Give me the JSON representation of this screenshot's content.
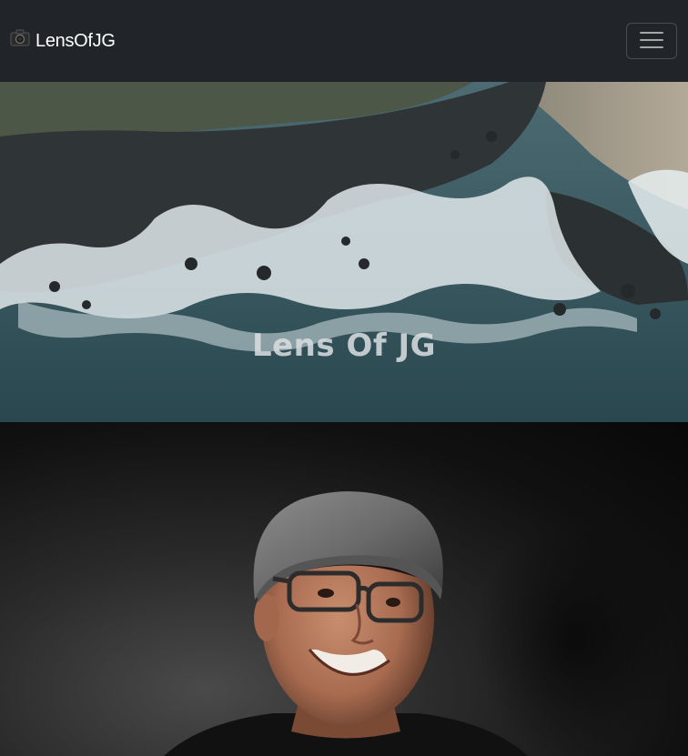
{
  "navbar": {
    "brand_icon": "camera-icon",
    "brand_text": "LensOfJG",
    "toggler_icon": "hamburger-menu-icon"
  },
  "hero": {
    "title": "Lens Of JG",
    "image": "aerial-coastline-waves-photo"
  },
  "portrait": {
    "image": "smiling-man-beanie-glasses-photo"
  },
  "colors": {
    "navbar_bg": "#212529",
    "brand_text": "#ffffff",
    "hero_title": "#d7dcde"
  }
}
